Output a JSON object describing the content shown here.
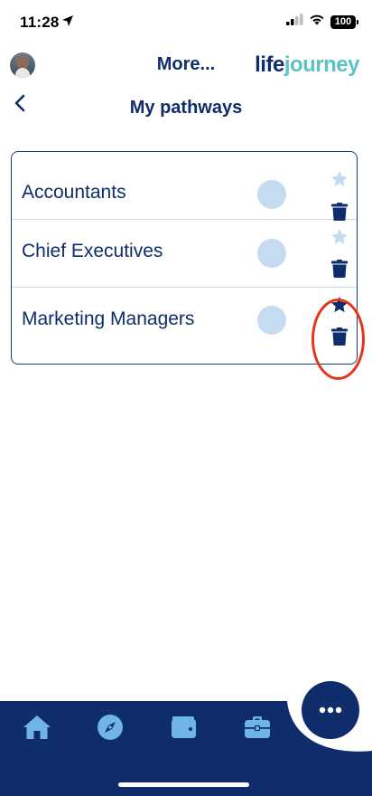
{
  "status_bar": {
    "time": "11:28",
    "battery": "100",
    "icons": [
      "location-arrow-icon",
      "signal-icon",
      "wifi-icon",
      "battery-icon"
    ]
  },
  "header": {
    "title": "More...",
    "logo_part1": "life",
    "logo_part2": "journey",
    "avatar": "user-avatar"
  },
  "page": {
    "title": "My pathways",
    "back_icon": "chevron-left-icon"
  },
  "pathways": [
    {
      "name": "Accountants",
      "starred": false
    },
    {
      "name": "Chief Executives",
      "starred": false
    },
    {
      "name": "Marketing Managers",
      "starred": true
    }
  ],
  "bottom_nav": {
    "items": [
      "home-icon",
      "compass-icon",
      "wallet-icon",
      "briefcase-icon"
    ],
    "more_icon": "ellipsis-icon"
  },
  "colors": {
    "primary": "#0f2d6b",
    "accent": "#5cc2c2",
    "light_blue": "#c4dbf1",
    "highlight": "#e8341c"
  }
}
